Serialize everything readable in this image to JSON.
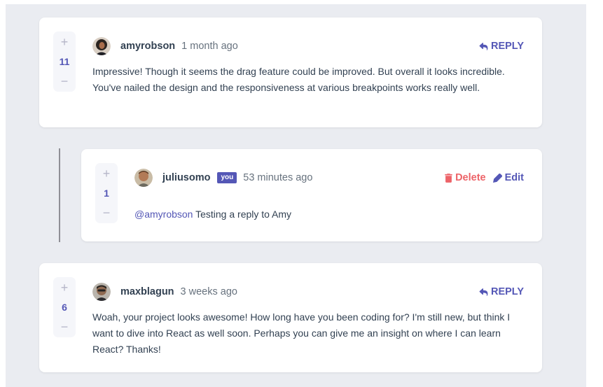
{
  "colors": {
    "accent": "#5457b6",
    "danger": "#ed6368",
    "text": "#324152",
    "muted": "#67727e",
    "background": "#eaecf1"
  },
  "comments": [
    {
      "score": "11",
      "username": "amyrobson",
      "time": "1 month ago",
      "reply_label": "REPLY",
      "content": "Impressive! Though it seems the drag feature could be improved. But overall it looks incredible. You've nailed the design and the responsiveness at various breakpoints works really well."
    },
    {
      "score": "6",
      "username": "maxblagun",
      "time": "3 weeks ago",
      "reply_label": "REPLY",
      "content": "Woah, your project looks awesome! How long have you been coding for? I'm still new, but think I want to dive into React as well soon. Perhaps you can give me an insight on where I can learn React? Thanks!"
    }
  ],
  "reply": {
    "score": "1",
    "username": "juliusomo",
    "you_badge": "you",
    "time": "53 minutes ago",
    "delete_label": "Delete",
    "edit_label": "Edit",
    "mention": "@amyrobson",
    "content": " Testing a reply to Amy"
  },
  "vote_icons": {
    "upvote": "plus-icon",
    "downvote": "minus-icon"
  }
}
